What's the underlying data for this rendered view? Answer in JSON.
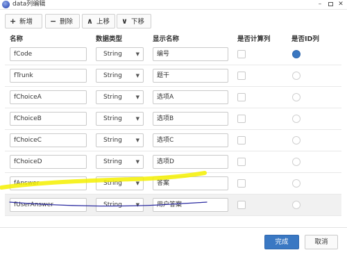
{
  "window": {
    "title": "data列编辑",
    "minimize": "–",
    "close": "✕"
  },
  "toolbar": {
    "add": {
      "icon": "+",
      "label": "新增"
    },
    "delete": {
      "icon": "−",
      "label": "删除"
    },
    "up": {
      "icon": "∧",
      "label": "上移"
    },
    "down": {
      "icon": "∨",
      "label": "下移"
    }
  },
  "columns": [
    "名称",
    "数据类型",
    "显示名称",
    "是否计算列",
    "是否ID列"
  ],
  "rows": [
    {
      "name": "fCode",
      "type": "String",
      "display": "编号",
      "calc": false,
      "id": true
    },
    {
      "name": "fTrunk",
      "type": "String",
      "display": "题干",
      "calc": false,
      "id": false
    },
    {
      "name": "fChoiceA",
      "type": "String",
      "display": "选项A",
      "calc": false,
      "id": false
    },
    {
      "name": "fChoiceB",
      "type": "String",
      "display": "选项B",
      "calc": false,
      "id": false
    },
    {
      "name": "fChoiceC",
      "type": "String",
      "display": "选项C",
      "calc": false,
      "id": false
    },
    {
      "name": "fChoiceD",
      "type": "String",
      "display": "选项D",
      "calc": false,
      "id": false
    },
    {
      "name": "fAnswer",
      "type": "String",
      "display": "答案",
      "calc": false,
      "id": false
    },
    {
      "name": "fUserAnswer",
      "type": "String",
      "display": "用户答案",
      "calc": false,
      "id": false
    }
  ],
  "footer": {
    "confirm": "完成",
    "cancel": "取消"
  },
  "colors": {
    "accent": "#3a78c3",
    "highlight_annotation": "#f5f000",
    "underline_annotation": "#2a2aa0"
  }
}
